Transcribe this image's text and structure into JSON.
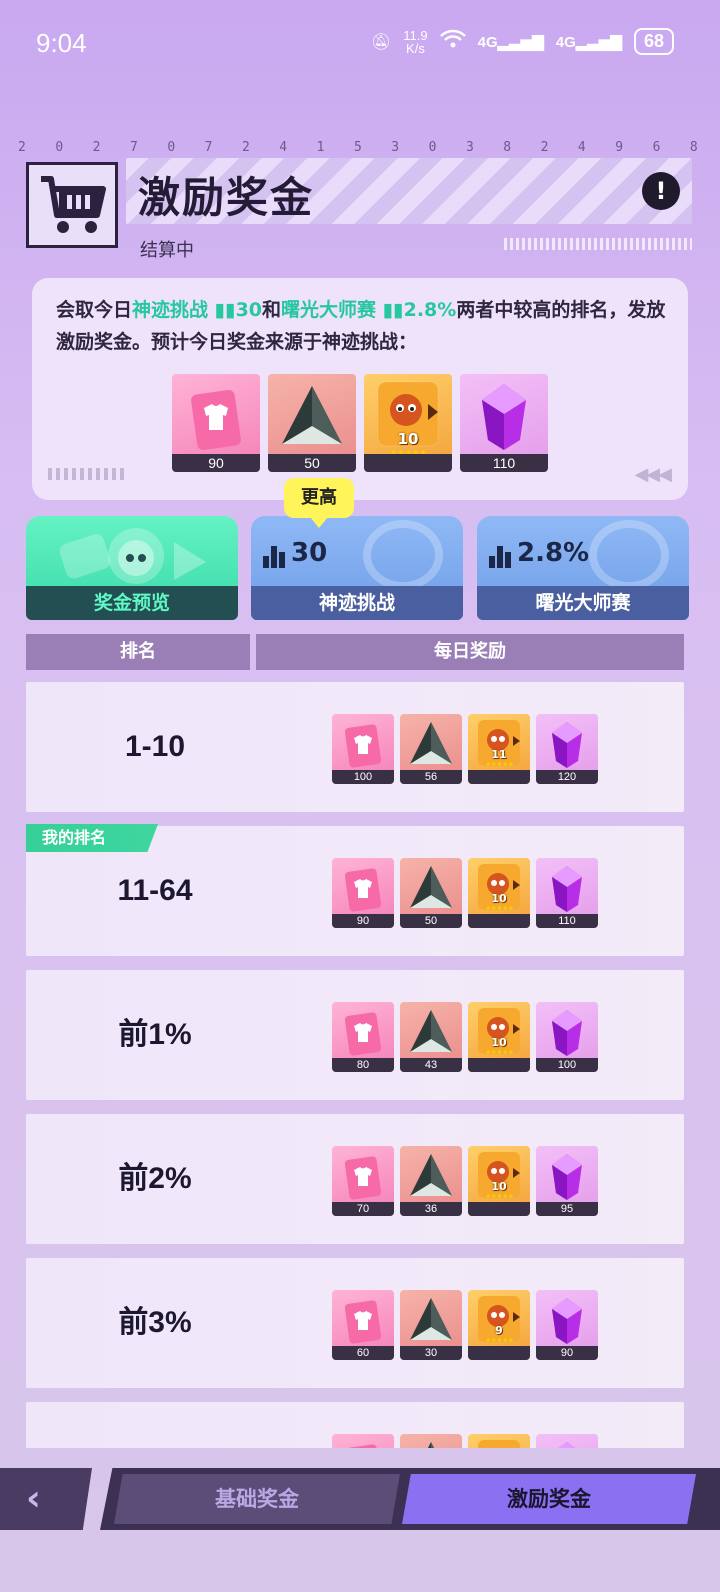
{
  "status_bar": {
    "time": "9:04",
    "net_speed_value": "11.9",
    "net_speed_unit": "K/s",
    "signal1": "4G",
    "signal2": "4G",
    "battery": "68"
  },
  "top_digits": [
    "2",
    "0",
    "2",
    "7",
    "0",
    "7",
    "2",
    "4",
    "1",
    "5",
    "3",
    "0",
    "3",
    "8",
    "2",
    "4",
    "9",
    "6",
    "8"
  ],
  "header": {
    "title": "激励奖金",
    "status": "结算中",
    "info_icon": "exclamation-icon",
    "info_label": "!"
  },
  "description": {
    "part1": "会取今日",
    "event1": "神迹挑战",
    "event1_value": "30",
    "and": "和",
    "event2": "曙光大师赛",
    "event2_value": "2.8%",
    "part2": "两者中较高的排名，发放激励奖金。预计今日奖金来源于神迹挑战：",
    "items": [
      {
        "icon": "shirt-ticket-icon",
        "count": "90"
      },
      {
        "icon": "triangle-crystal-icon",
        "count": "50"
      },
      {
        "icon": "pet-card-icon",
        "level": "10",
        "stars": "✦✦✦✦✦",
        "count": ""
      },
      {
        "icon": "purple-gem-icon",
        "count": "110"
      }
    ]
  },
  "tooltip": "更高",
  "cards": {
    "preview": {
      "label": "奖金预览"
    },
    "miracle": {
      "label": "神迹挑战",
      "value": "30"
    },
    "dawn": {
      "label": "曙光大师赛",
      "value": "2.8%"
    }
  },
  "table": {
    "col_rank": "排名",
    "col_reward": "每日奖励",
    "my_rank_badge": "我的排名",
    "rows": [
      {
        "rank": "1-10",
        "shirt": "100",
        "tri": "56",
        "pet_level": "11",
        "gem": "120"
      },
      {
        "rank": "11-64",
        "shirt": "90",
        "tri": "50",
        "pet_level": "10",
        "gem": "110"
      },
      {
        "rank": "前1%",
        "shirt": "80",
        "tri": "43",
        "pet_level": "10",
        "gem": "100"
      },
      {
        "rank": "前2%",
        "shirt": "70",
        "tri": "36",
        "pet_level": "10",
        "gem": "95"
      },
      {
        "rank": "前3%",
        "shirt": "60",
        "tri": "30",
        "pet_level": "9",
        "gem": "90"
      }
    ],
    "stars": "✦✦✦✦✦"
  },
  "bottom_nav": {
    "back_icon": "chevron-left-icon",
    "back_glyph": "‹",
    "tab_basic": "基础奖金",
    "tab_incentive": "激励奖金",
    "active_tab": "激励奖金"
  },
  "colors": {
    "highlight": "#27c7a0",
    "active_tab": "#8c70f2",
    "tooltip": "#fff45a"
  }
}
